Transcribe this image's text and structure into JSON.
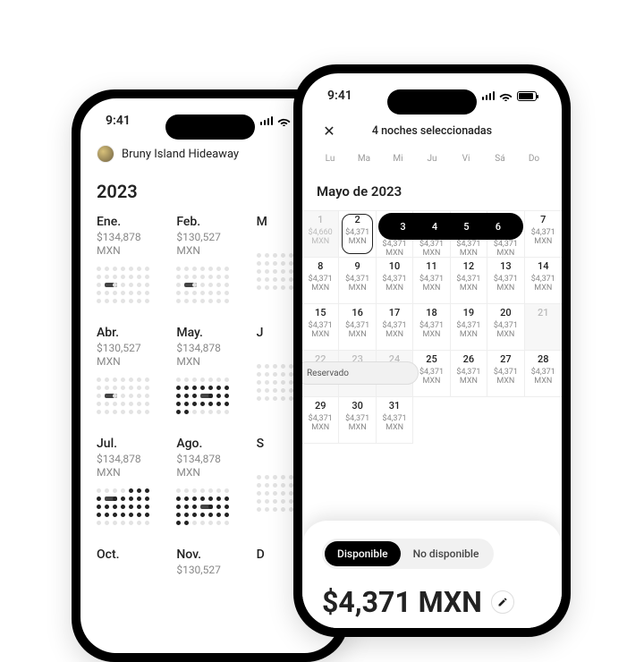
{
  "status": {
    "time": "9:41"
  },
  "left": {
    "listing_name": "Bruny Island Hideaway",
    "year": "2023",
    "currency": "MXN",
    "months": [
      {
        "name": "Ene.",
        "price": "$134,878"
      },
      {
        "name": "Feb.",
        "price": "$130,527"
      },
      {
        "name": "M",
        "price": ""
      },
      {
        "name": "Abr.",
        "price": "$130,527"
      },
      {
        "name": "May.",
        "price": "$134,878"
      },
      {
        "name": "J",
        "price": ""
      },
      {
        "name": "Jul.",
        "price": "$134,878"
      },
      {
        "name": "Ago.",
        "price": "$134,878"
      },
      {
        "name": "S",
        "price": ""
      },
      {
        "name": "Oct.",
        "price": ""
      },
      {
        "name": "Nov.",
        "price": "$130,527"
      },
      {
        "name": "D",
        "price": ""
      }
    ]
  },
  "right": {
    "title": "4 noches seleccionadas",
    "weekdays": [
      "Lu",
      "Ma",
      "Mi",
      "Ju",
      "Vi",
      "Sá",
      "Do"
    ],
    "month_title": "Mayo de 2023",
    "currency": "MXN",
    "day1_price": "$4,660",
    "std_price": "$4,371",
    "selected_days": [
      "3",
      "4",
      "5",
      "6"
    ],
    "reserved_label": "Reservado",
    "segment": {
      "available": "Disponible",
      "unavailable": "No disponible"
    },
    "big_price": "$4,371 MXN"
  }
}
